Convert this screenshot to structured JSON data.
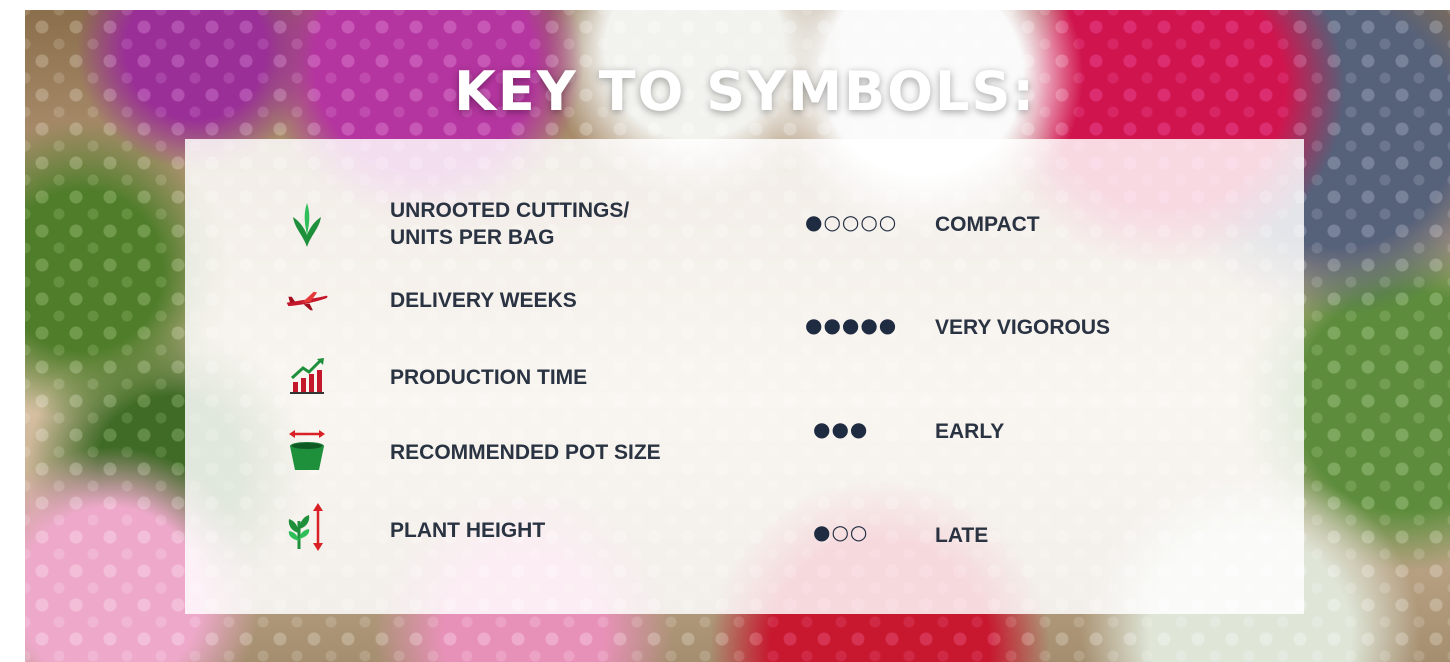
{
  "title": "KEY TO SYMBOLS:",
  "left_items": [
    {
      "icon": "leaf-cutting-icon",
      "label_line1": "UNROOTED CUTTINGS/",
      "label_line2": "UNITS PER BAG"
    },
    {
      "icon": "airplane-icon",
      "label_line1": "DELIVERY WEEKS"
    },
    {
      "icon": "growth-chart-icon",
      "label_line1": "PRODUCTION TIME"
    },
    {
      "icon": "pot-size-icon",
      "label_line1": "RECOMMENDED POT SIZE"
    },
    {
      "icon": "plant-height-icon",
      "label_line1": "PLANT HEIGHT"
    }
  ],
  "right_items": [
    {
      "dots": "●○○○○",
      "label": "COMPACT"
    },
    {
      "dots": "●●●●●",
      "label": "VERY VIGOROUS"
    },
    {
      "dots": "●●●",
      "label": "EARLY"
    },
    {
      "dots": "●○○",
      "label": "LATE"
    }
  ],
  "colors": {
    "text": "#2a3342",
    "leaf_green": "#1e8f3a",
    "accent_red": "#d92027"
  }
}
